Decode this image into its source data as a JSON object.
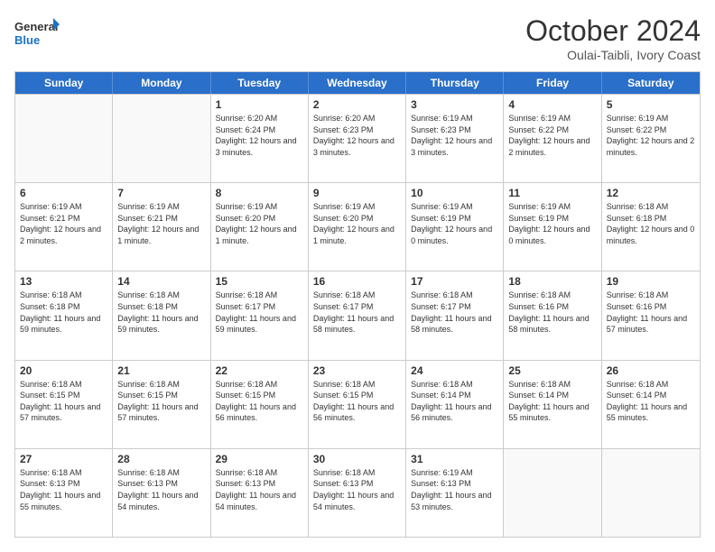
{
  "logo": {
    "line1": "General",
    "line2": "Blue"
  },
  "title": "October 2024",
  "location": "Oulai-Taibli, Ivory Coast",
  "days_of_week": [
    "Sunday",
    "Monday",
    "Tuesday",
    "Wednesday",
    "Thursday",
    "Friday",
    "Saturday"
  ],
  "weeks": [
    [
      {
        "day": "",
        "empty": true
      },
      {
        "day": "",
        "empty": true
      },
      {
        "day": "1",
        "sunrise": "6:20 AM",
        "sunset": "6:24 PM",
        "daylight": "12 hours and 3 minutes."
      },
      {
        "day": "2",
        "sunrise": "6:20 AM",
        "sunset": "6:23 PM",
        "daylight": "12 hours and 3 minutes."
      },
      {
        "day": "3",
        "sunrise": "6:19 AM",
        "sunset": "6:23 PM",
        "daylight": "12 hours and 3 minutes."
      },
      {
        "day": "4",
        "sunrise": "6:19 AM",
        "sunset": "6:22 PM",
        "daylight": "12 hours and 2 minutes."
      },
      {
        "day": "5",
        "sunrise": "6:19 AM",
        "sunset": "6:22 PM",
        "daylight": "12 hours and 2 minutes."
      }
    ],
    [
      {
        "day": "6",
        "sunrise": "6:19 AM",
        "sunset": "6:21 PM",
        "daylight": "12 hours and 2 minutes."
      },
      {
        "day": "7",
        "sunrise": "6:19 AM",
        "sunset": "6:21 PM",
        "daylight": "12 hours and 1 minute."
      },
      {
        "day": "8",
        "sunrise": "6:19 AM",
        "sunset": "6:20 PM",
        "daylight": "12 hours and 1 minute."
      },
      {
        "day": "9",
        "sunrise": "6:19 AM",
        "sunset": "6:20 PM",
        "daylight": "12 hours and 1 minute."
      },
      {
        "day": "10",
        "sunrise": "6:19 AM",
        "sunset": "6:19 PM",
        "daylight": "12 hours and 0 minutes."
      },
      {
        "day": "11",
        "sunrise": "6:19 AM",
        "sunset": "6:19 PM",
        "daylight": "12 hours and 0 minutes."
      },
      {
        "day": "12",
        "sunrise": "6:18 AM",
        "sunset": "6:18 PM",
        "daylight": "12 hours and 0 minutes."
      }
    ],
    [
      {
        "day": "13",
        "sunrise": "6:18 AM",
        "sunset": "6:18 PM",
        "daylight": "11 hours and 59 minutes."
      },
      {
        "day": "14",
        "sunrise": "6:18 AM",
        "sunset": "6:18 PM",
        "daylight": "11 hours and 59 minutes."
      },
      {
        "day": "15",
        "sunrise": "6:18 AM",
        "sunset": "6:17 PM",
        "daylight": "11 hours and 59 minutes."
      },
      {
        "day": "16",
        "sunrise": "6:18 AM",
        "sunset": "6:17 PM",
        "daylight": "11 hours and 58 minutes."
      },
      {
        "day": "17",
        "sunrise": "6:18 AM",
        "sunset": "6:17 PM",
        "daylight": "11 hours and 58 minutes."
      },
      {
        "day": "18",
        "sunrise": "6:18 AM",
        "sunset": "6:16 PM",
        "daylight": "11 hours and 58 minutes."
      },
      {
        "day": "19",
        "sunrise": "6:18 AM",
        "sunset": "6:16 PM",
        "daylight": "11 hours and 57 minutes."
      }
    ],
    [
      {
        "day": "20",
        "sunrise": "6:18 AM",
        "sunset": "6:15 PM",
        "daylight": "11 hours and 57 minutes."
      },
      {
        "day": "21",
        "sunrise": "6:18 AM",
        "sunset": "6:15 PM",
        "daylight": "11 hours and 57 minutes."
      },
      {
        "day": "22",
        "sunrise": "6:18 AM",
        "sunset": "6:15 PM",
        "daylight": "11 hours and 56 minutes."
      },
      {
        "day": "23",
        "sunrise": "6:18 AM",
        "sunset": "6:15 PM",
        "daylight": "11 hours and 56 minutes."
      },
      {
        "day": "24",
        "sunrise": "6:18 AM",
        "sunset": "6:14 PM",
        "daylight": "11 hours and 56 minutes."
      },
      {
        "day": "25",
        "sunrise": "6:18 AM",
        "sunset": "6:14 PM",
        "daylight": "11 hours and 55 minutes."
      },
      {
        "day": "26",
        "sunrise": "6:18 AM",
        "sunset": "6:14 PM",
        "daylight": "11 hours and 55 minutes."
      }
    ],
    [
      {
        "day": "27",
        "sunrise": "6:18 AM",
        "sunset": "6:13 PM",
        "daylight": "11 hours and 55 minutes."
      },
      {
        "day": "28",
        "sunrise": "6:18 AM",
        "sunset": "6:13 PM",
        "daylight": "11 hours and 54 minutes."
      },
      {
        "day": "29",
        "sunrise": "6:18 AM",
        "sunset": "6:13 PM",
        "daylight": "11 hours and 54 minutes."
      },
      {
        "day": "30",
        "sunrise": "6:18 AM",
        "sunset": "6:13 PM",
        "daylight": "11 hours and 54 minutes."
      },
      {
        "day": "31",
        "sunrise": "6:19 AM",
        "sunset": "6:13 PM",
        "daylight": "11 hours and 53 minutes."
      },
      {
        "day": "",
        "empty": true
      },
      {
        "day": "",
        "empty": true
      }
    ]
  ]
}
